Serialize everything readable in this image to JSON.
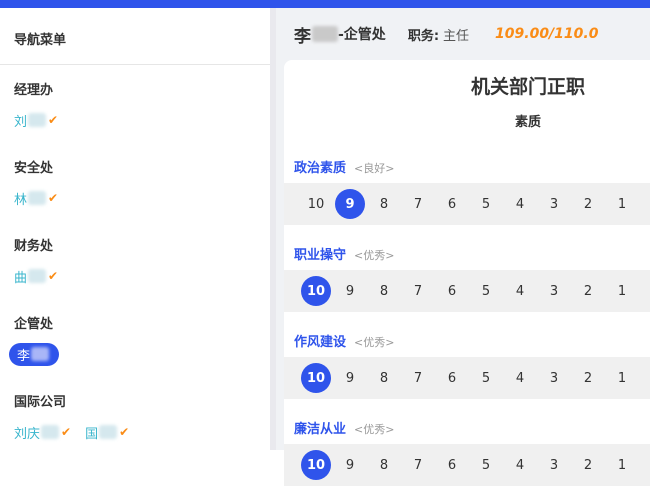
{
  "sidebar": {
    "title": "导航菜单",
    "departments": [
      {
        "label": "经理办",
        "people": [
          {
            "name": "刘",
            "checked": true
          }
        ]
      },
      {
        "label": "安全处",
        "people": [
          {
            "name": "林",
            "checked": true
          }
        ]
      },
      {
        "label": "财务处",
        "people": [
          {
            "name": "曲",
            "checked": true
          }
        ]
      },
      {
        "label": "企管处",
        "people": [
          {
            "name": "李",
            "checked": false,
            "active": true
          }
        ]
      },
      {
        "label": "国际公司",
        "people": [
          {
            "name": "刘庆",
            "checked": true
          },
          {
            "name": "国",
            "checked": true
          }
        ]
      }
    ]
  },
  "header": {
    "name": "李",
    "dept": "-企管处",
    "role_label": "职务:",
    "role": "主任",
    "score": "109.00/110.0"
  },
  "card": {
    "title": "机关部门正职",
    "subtitle": "素质"
  },
  "criteria": [
    {
      "name": "政治素质",
      "grade": "<良好>",
      "selected": 9
    },
    {
      "name": "职业操守",
      "grade": "<优秀>",
      "selected": 10
    },
    {
      "name": "作风建设",
      "grade": "<优秀>",
      "selected": 10
    },
    {
      "name": "廉洁从业",
      "grade": "<优秀>",
      "selected": 10
    }
  ],
  "scale": [
    10,
    9,
    8,
    7,
    6,
    5,
    4,
    3,
    2,
    1
  ],
  "colors": {
    "accent": "#2f54eb",
    "score": "#fa8c16",
    "person": "#38b5cc"
  }
}
